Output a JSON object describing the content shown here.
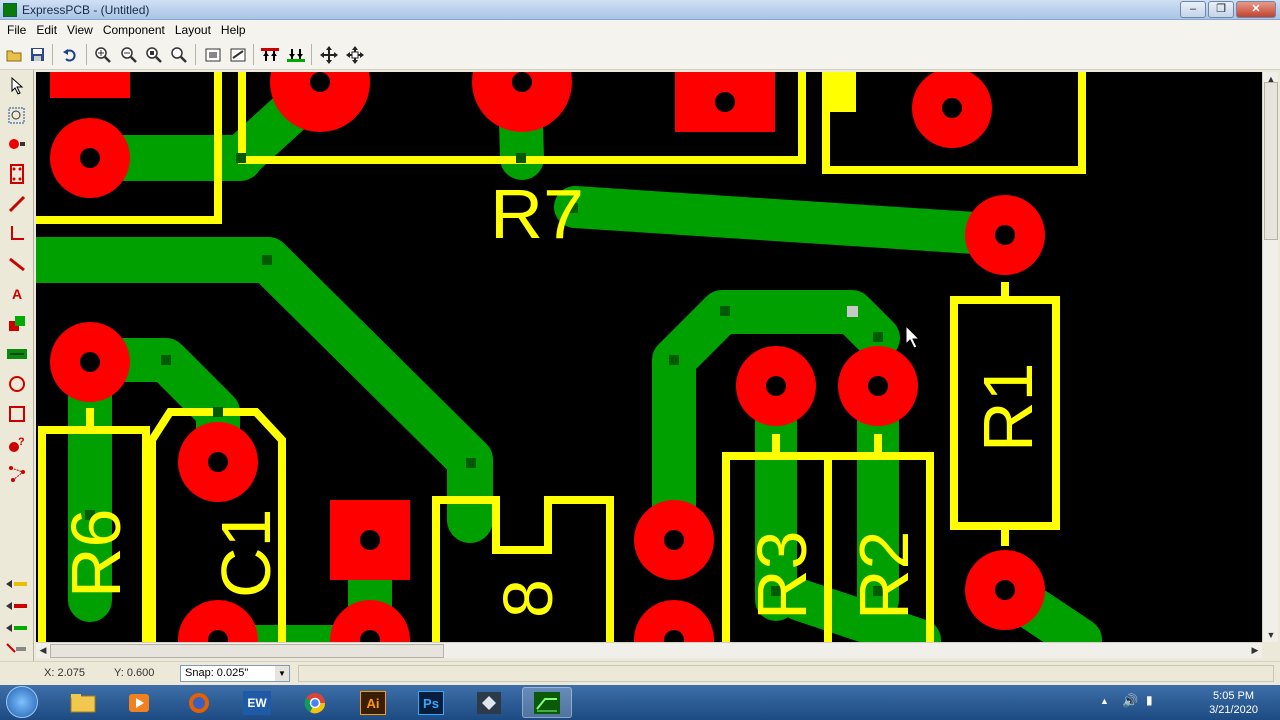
{
  "window": {
    "title": "ExpressPCB - (Untitled)"
  },
  "menu": [
    "File",
    "Edit",
    "View",
    "Component",
    "Layout",
    "Help"
  ],
  "toolbar_icons": [
    "open-file-icon",
    "save-icon",
    "undo-icon",
    "zoom-in-icon",
    "zoom-out-icon",
    "zoom-window-icon",
    "zoom-fit-icon",
    "properties-icon",
    "measure-icon",
    "layer-top-icon",
    "layer-bottom-icon",
    "pan-icon",
    "pan-center-icon"
  ],
  "palette_icons": [
    "select-arrow-icon",
    "zoom-area-icon",
    "place-pad-icon",
    "place-component-icon",
    "draw-trace-icon",
    "draw-line-icon",
    "draw-segment-icon",
    "text-icon",
    "ground-plane-icon",
    "connector-icon",
    "circle-icon",
    "rectangle-icon",
    "pad-question-icon",
    "netlist-icon",
    "layer-1-icon",
    "layer-2-icon",
    "layer-3-icon",
    "layer-4-icon"
  ],
  "pcb": {
    "labels": [
      "R7",
      "R1",
      "R6",
      "C1",
      "R3",
      "R2",
      "8"
    ]
  },
  "status": {
    "x": "X: 2.075",
    "y": "Y: 0.600",
    "snap": "Snap: 0.025\""
  },
  "taskbar": {
    "apps": [
      "file-explorer-icon",
      "media-player-icon",
      "firefox-icon",
      "EW",
      "chrome-icon",
      "Ai",
      "Ps",
      "media-encoder-icon",
      "expresspcb-icon"
    ],
    "time": "5:05 PM",
    "date": "3/21/2020"
  }
}
